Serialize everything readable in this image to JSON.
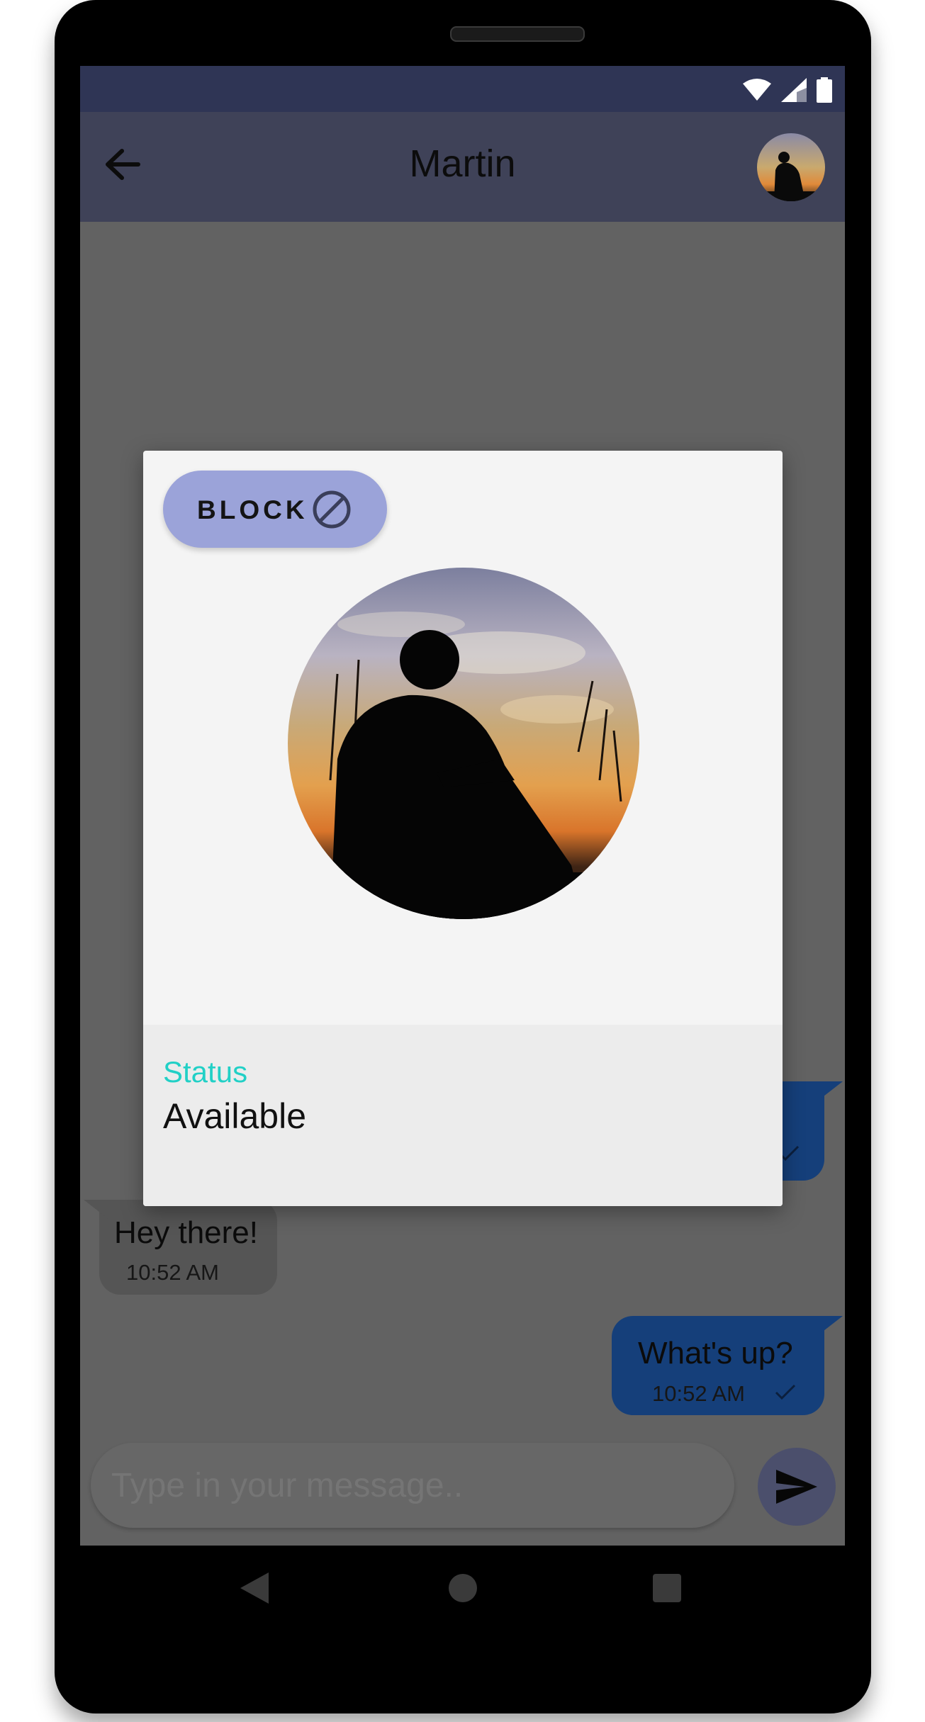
{
  "app_bar": {
    "title": "Martin"
  },
  "messages": [
    {
      "text": "Hey there!",
      "time": "10:52 AM",
      "direction": "incoming"
    },
    {
      "text": "What's up?",
      "time": "10:52 AM",
      "direction": "outgoing",
      "status": "sent"
    }
  ],
  "composer": {
    "placeholder": "Type in your message.."
  },
  "profile_dialog": {
    "block_label": "BLOCK",
    "status_label": "Status",
    "status_value": "Available"
  },
  "colors": {
    "accent_status": "#21d0c6",
    "block_button": "#9ba3d9",
    "outgoing_bubble": "#153f7a",
    "app_bar": "#3f4258"
  },
  "icons": {
    "back": "arrow-left-icon",
    "block": "block-icon",
    "send": "send-icon",
    "check": "check-icon",
    "wifi": "wifi-icon",
    "signal": "signal-icon",
    "battery": "battery-icon",
    "nav_back": "nav-back-icon",
    "nav_home": "nav-home-icon",
    "nav_recents": "nav-recents-icon"
  }
}
